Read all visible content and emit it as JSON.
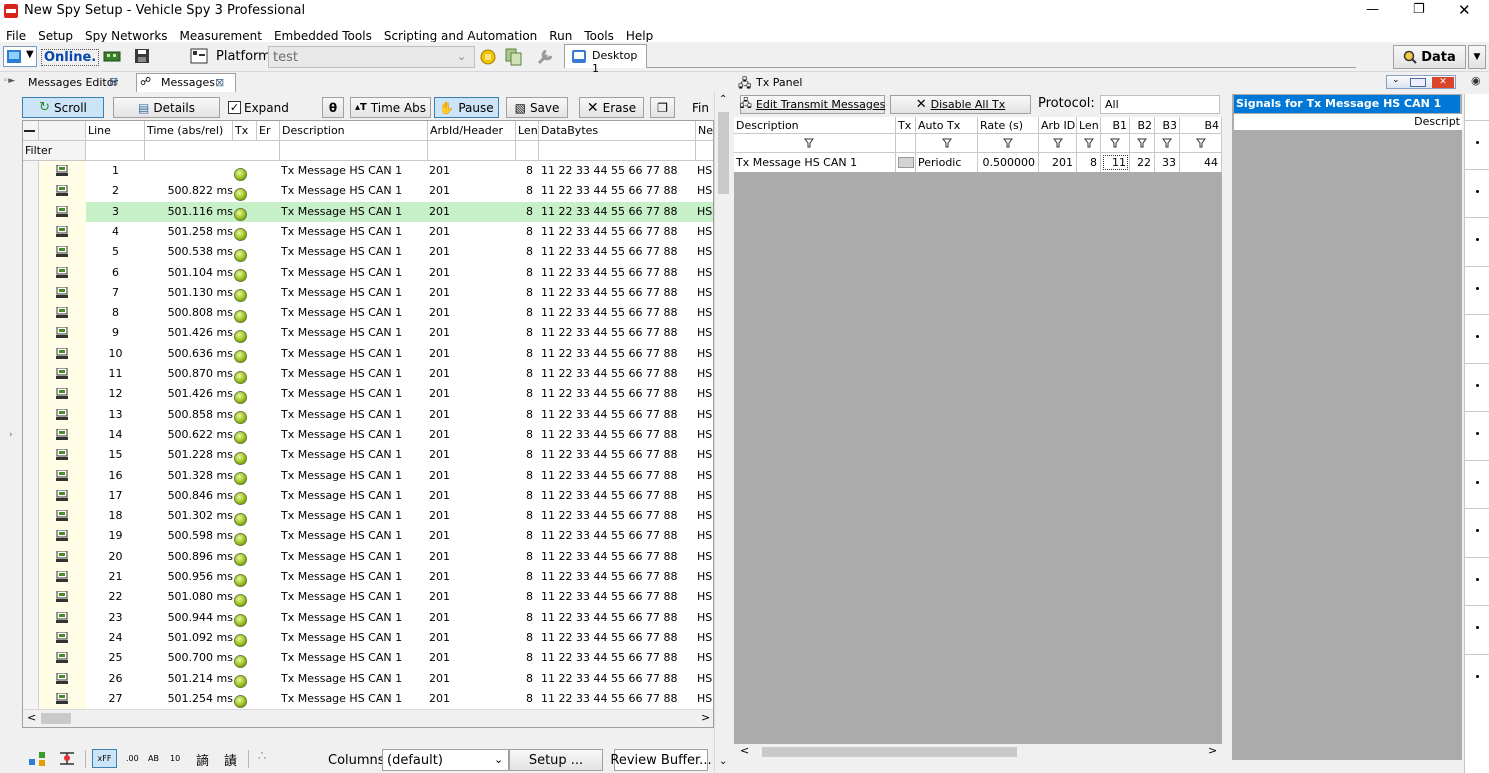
{
  "window": {
    "title": "New Spy Setup - Vehicle Spy 3 Professional"
  },
  "menu": [
    "File",
    "Setup",
    "Spy Networks",
    "Measurement",
    "Embedded Tools",
    "Scripting and Automation",
    "Run",
    "Tools",
    "Help"
  ],
  "toolbar": {
    "online_label": "Online.",
    "platform_label": "Platform:",
    "platform_value": "test",
    "desktop_tab": "Desktop 1",
    "data_button": "Data"
  },
  "msg_tabs": {
    "editor": "Messages Editor",
    "messages": "Messages",
    "close": "⊠"
  },
  "msg_toolbar": {
    "scroll": "Scroll",
    "details": "Details",
    "expand": "Expand",
    "time_abs": "Time Abs",
    "pause": "Pause",
    "save": "Save",
    "erase": "Erase",
    "find": "Fin"
  },
  "grid": {
    "filter_label": "Filter",
    "headers": [
      "Line",
      "Time (abs/rel)",
      "Tx",
      "Er",
      "Description",
      "ArbId/Header",
      "Len",
      "DataBytes",
      "Ne"
    ],
    "rows": [
      {
        "line": "1",
        "time": "",
        "desc": "Tx Message HS CAN 1",
        "arb": "201",
        "len": "8",
        "data": "11 22 33 44 55 66 77 88",
        "net": "HS"
      },
      {
        "line": "2",
        "time": "500.822 ms",
        "desc": "Tx Message HS CAN 1",
        "arb": "201",
        "len": "8",
        "data": "11 22 33 44 55 66 77 88",
        "net": "HS"
      },
      {
        "line": "3",
        "time": "501.116 ms",
        "desc": "Tx Message HS CAN 1",
        "arb": "201",
        "len": "8",
        "data": "11 22 33 44 55 66 77 88",
        "net": "HS"
      },
      {
        "line": "4",
        "time": "501.258 ms",
        "desc": "Tx Message HS CAN 1",
        "arb": "201",
        "len": "8",
        "data": "11 22 33 44 55 66 77 88",
        "net": "HS"
      },
      {
        "line": "5",
        "time": "500.538 ms",
        "desc": "Tx Message HS CAN 1",
        "arb": "201",
        "len": "8",
        "data": "11 22 33 44 55 66 77 88",
        "net": "HS"
      },
      {
        "line": "6",
        "time": "501.104 ms",
        "desc": "Tx Message HS CAN 1",
        "arb": "201",
        "len": "8",
        "data": "11 22 33 44 55 66 77 88",
        "net": "HS"
      },
      {
        "line": "7",
        "time": "501.130 ms",
        "desc": "Tx Message HS CAN 1",
        "arb": "201",
        "len": "8",
        "data": "11 22 33 44 55 66 77 88",
        "net": "HS"
      },
      {
        "line": "8",
        "time": "500.808 ms",
        "desc": "Tx Message HS CAN 1",
        "arb": "201",
        "len": "8",
        "data": "11 22 33 44 55 66 77 88",
        "net": "HS"
      },
      {
        "line": "9",
        "time": "501.426 ms",
        "desc": "Tx Message HS CAN 1",
        "arb": "201",
        "len": "8",
        "data": "11 22 33 44 55 66 77 88",
        "net": "HS"
      },
      {
        "line": "10",
        "time": "500.636 ms",
        "desc": "Tx Message HS CAN 1",
        "arb": "201",
        "len": "8",
        "data": "11 22 33 44 55 66 77 88",
        "net": "HS"
      },
      {
        "line": "11",
        "time": "500.870 ms",
        "desc": "Tx Message HS CAN 1",
        "arb": "201",
        "len": "8",
        "data": "11 22 33 44 55 66 77 88",
        "net": "HS"
      },
      {
        "line": "12",
        "time": "501.426 ms",
        "desc": "Tx Message HS CAN 1",
        "arb": "201",
        "len": "8",
        "data": "11 22 33 44 55 66 77 88",
        "net": "HS"
      },
      {
        "line": "13",
        "time": "500.858 ms",
        "desc": "Tx Message HS CAN 1",
        "arb": "201",
        "len": "8",
        "data": "11 22 33 44 55 66 77 88",
        "net": "HS"
      },
      {
        "line": "14",
        "time": "500.622 ms",
        "desc": "Tx Message HS CAN 1",
        "arb": "201",
        "len": "8",
        "data": "11 22 33 44 55 66 77 88",
        "net": "HS"
      },
      {
        "line": "15",
        "time": "501.228 ms",
        "desc": "Tx Message HS CAN 1",
        "arb": "201",
        "len": "8",
        "data": "11 22 33 44 55 66 77 88",
        "net": "HS"
      },
      {
        "line": "16",
        "time": "501.328 ms",
        "desc": "Tx Message HS CAN 1",
        "arb": "201",
        "len": "8",
        "data": "11 22 33 44 55 66 77 88",
        "net": "HS"
      },
      {
        "line": "17",
        "time": "500.846 ms",
        "desc": "Tx Message HS CAN 1",
        "arb": "201",
        "len": "8",
        "data": "11 22 33 44 55 66 77 88",
        "net": "HS"
      },
      {
        "line": "18",
        "time": "501.302 ms",
        "desc": "Tx Message HS CAN 1",
        "arb": "201",
        "len": "8",
        "data": "11 22 33 44 55 66 77 88",
        "net": "HS"
      },
      {
        "line": "19",
        "time": "500.598 ms",
        "desc": "Tx Message HS CAN 1",
        "arb": "201",
        "len": "8",
        "data": "11 22 33 44 55 66 77 88",
        "net": "HS"
      },
      {
        "line": "20",
        "time": "500.896 ms",
        "desc": "Tx Message HS CAN 1",
        "arb": "201",
        "len": "8",
        "data": "11 22 33 44 55 66 77 88",
        "net": "HS"
      },
      {
        "line": "21",
        "time": "500.956 ms",
        "desc": "Tx Message HS CAN 1",
        "arb": "201",
        "len": "8",
        "data": "11 22 33 44 55 66 77 88",
        "net": "HS"
      },
      {
        "line": "22",
        "time": "501.080 ms",
        "desc": "Tx Message HS CAN 1",
        "arb": "201",
        "len": "8",
        "data": "11 22 33 44 55 66 77 88",
        "net": "HS"
      },
      {
        "line": "23",
        "time": "500.944 ms",
        "desc": "Tx Message HS CAN 1",
        "arb": "201",
        "len": "8",
        "data": "11 22 33 44 55 66 77 88",
        "net": "HS"
      },
      {
        "line": "24",
        "time": "501.092 ms",
        "desc": "Tx Message HS CAN 1",
        "arb": "201",
        "len": "8",
        "data": "11 22 33 44 55 66 77 88",
        "net": "HS"
      },
      {
        "line": "25",
        "time": "500.700 ms",
        "desc": "Tx Message HS CAN 1",
        "arb": "201",
        "len": "8",
        "data": "11 22 33 44 55 66 77 88",
        "net": "HS"
      },
      {
        "line": "26",
        "time": "501.214 ms",
        "desc": "Tx Message HS CAN 1",
        "arb": "201",
        "len": "8",
        "data": "11 22 33 44 55 66 77 88",
        "net": "HS"
      },
      {
        "line": "27",
        "time": "501.254 ms",
        "desc": "Tx Message HS CAN 1",
        "arb": "201",
        "len": "8",
        "data": "11 22 33 44 55 66 77 88",
        "net": "HS"
      }
    ],
    "selected_line": "3"
  },
  "bottom_bar": {
    "hex_ff": "xFF",
    "dec_00": ".00",
    "ab": "AB",
    "ten": "10",
    "columns_label": "Columns",
    "columns_value": "(default)",
    "setup": "Setup ...",
    "review": "Review Buffer..."
  },
  "tx_panel": {
    "title": "Tx Panel",
    "edit_button": "Edit Transmit Messages",
    "disable_button": "Disable All Tx",
    "protocol_label": "Protocol:",
    "protocol_value": "All",
    "headers": [
      "Description",
      "Tx",
      "Auto Tx",
      "Rate (s)",
      "Arb ID",
      "Len",
      "B1",
      "B2",
      "B3",
      "B4"
    ],
    "row": {
      "desc": "Tx Message HS CAN 1",
      "auto_tx": "Periodic",
      "rate": "0.500000",
      "arb": "201",
      "len": "8",
      "b1": "11",
      "b2": "22",
      "b3": "33",
      "b4": "44"
    }
  },
  "signals": {
    "title": "Signals for Tx Message HS CAN 1",
    "col": "Descript"
  },
  "colors": {
    "selected_row": "#c8f0c8",
    "signals_header": "#0078d7",
    "panel_gray": "#ababab"
  }
}
